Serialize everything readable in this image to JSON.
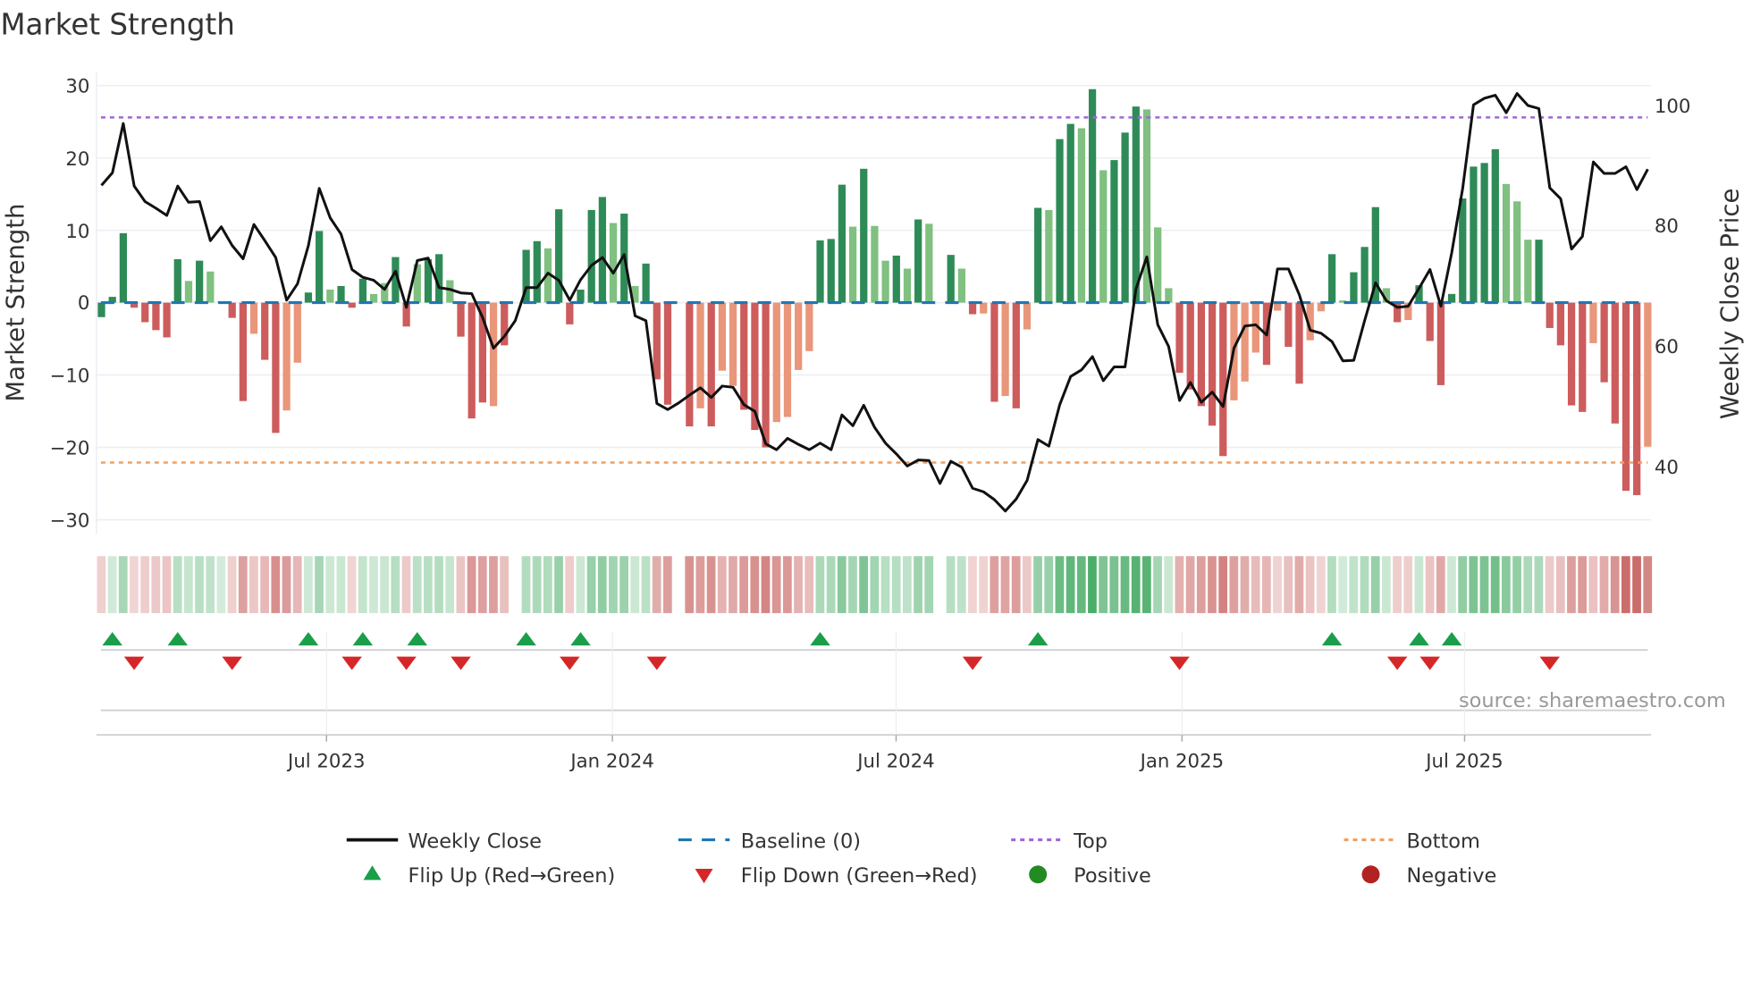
{
  "chart_data": {
    "type": "bar",
    "title": "Market Strength",
    "ylabel": "Market Strength",
    "y2label": "Weekly Close Price",
    "ylim": [
      -32,
      32
    ],
    "y2lim": [
      33,
      104
    ],
    "yticks": [
      "30",
      "20",
      "10",
      "0",
      "−10",
      "−20",
      "−30"
    ],
    "ytick_values": [
      30,
      20,
      10,
      0,
      -10,
      -20,
      -30
    ],
    "y2ticks": [
      "100",
      "80",
      "60",
      "40"
    ],
    "y2tick_values": [
      100,
      80,
      60,
      40
    ],
    "xticks": [
      "Jul 2023",
      "Jan 2024",
      "Jul 2024",
      "Jan 2025",
      "Jul 2025"
    ],
    "xtick_week_index": [
      21.2,
      47.5,
      73.5,
      99.7,
      125.7
    ],
    "top_level": 25.6,
    "bottom_level": -22.1,
    "baseline": 0,
    "grid": true,
    "legend_placement": "bottom",
    "strength": [
      -2.0,
      0.8,
      9.6,
      -0.7,
      -2.7,
      -3.8,
      -4.8,
      6.0,
      3.0,
      5.8,
      4.3,
      0.2,
      -2.1,
      -13.6,
      -4.3,
      -7.9,
      -18.0,
      -14.9,
      -8.3,
      1.4,
      9.9,
      1.8,
      2.3,
      -0.7,
      3.3,
      1.2,
      2.7,
      6.3,
      -3.3,
      5.3,
      6.0,
      6.7,
      3.1,
      -4.7,
      -16.0,
      -13.8,
      -14.3,
      -5.9,
      0,
      7.3,
      8.5,
      7.5,
      12.9,
      -3.0,
      1.8,
      12.8,
      14.6,
      11.0,
      12.3,
      2.3,
      5.4,
      -10.6,
      -14.1,
      0,
      -17.1,
      -14.6,
      -17.1,
      -9.4,
      -11.5,
      -14.8,
      -17.6,
      -20.0,
      -16.5,
      -15.8,
      -9.3,
      -6.7,
      8.6,
      8.8,
      16.3,
      10.5,
      18.5,
      10.6,
      5.8,
      6.5,
      4.7,
      11.5,
      10.9,
      0,
      6.6,
      4.7,
      -1.6,
      -1.5,
      -13.7,
      -12.9,
      -14.6,
      -3.7,
      13.1,
      12.8,
      22.6,
      24.7,
      24.1,
      29.5,
      18.3,
      19.7,
      23.5,
      27.1,
      26.7,
      10.4,
      2.0,
      -9.7,
      -12.0,
      -14.3,
      -17.0,
      -21.2,
      -13.5,
      -10.9,
      -6.9,
      -8.6,
      -1.1,
      -6.1,
      -11.2,
      -5.2,
      -1.2,
      6.7,
      0.3,
      4.2,
      7.7,
      13.2,
      2.0,
      -2.7,
      -2.4,
      2.4,
      -5.3,
      -11.4,
      1.2,
      14.4,
      18.8,
      19.3,
      21.2,
      16.4,
      14.0,
      8.7,
      8.7,
      -3.5,
      -5.9,
      -14.2,
      -15.1,
      -5.6,
      -11.0,
      -16.7,
      -26.0,
      -26.6,
      -19.9
    ],
    "bar_shade": "GGGRRRRGLGLLRRSRRSSGGLGRGLLGRLGGLRRRSRSGGLGRGGGLGLGRRSRSRSSRRRSSSSGGGLGLLGLGLSGLRSRSRSGLGGLGLGGGLLLRRRRRSSSRSRRSSGLGGGLRSGRRGGGGGLLLGRRRRSRRRRS",
    "weekly_close": [
      86.8,
      88.9,
      97.1,
      86.7,
      84.1,
      83.0,
      81.8,
      86.7,
      84.0,
      84.1,
      77.6,
      79.9,
      76.8,
      74.6,
      80.3,
      77.6,
      74.8,
      67.7,
      70.4,
      76.8,
      86.3,
      81.4,
      78.7,
      72.8,
      71.5,
      71.0,
      69.5,
      72.5,
      66.5,
      74.3,
      74.7,
      69.8,
      69.5,
      68.9,
      68.8,
      64.8,
      59.7,
      61.7,
      64.3,
      69.8,
      69.8,
      72.2,
      71.0,
      67.7,
      71.1,
      73.5,
      74.8,
      72.2,
      75.3,
      65.1,
      64.3,
      50.5,
      49.5,
      50.6,
      51.9,
      53.1,
      51.5,
      53.4,
      53.2,
      50.3,
      49.2,
      43.8,
      42.8,
      44.7,
      43.7,
      42.8,
      43.9,
      42.8,
      48.6,
      46.8,
      50.2,
      46.5,
      43.9,
      42.1,
      40.1,
      41.1,
      41.0,
      37.2,
      40.9,
      39.9,
      36.4,
      35.8,
      34.5,
      32.6,
      34.6,
      37.7,
      44.5,
      43.4,
      50.3,
      55.0,
      56.1,
      58.3,
      54.3,
      56.6,
      56.6,
      69.6,
      74.9,
      63.6,
      60.0,
      51.0,
      54.0,
      50.7,
      52.4,
      50.0,
      59.7,
      63.4,
      63.6,
      61.9,
      72.9,
      72.9,
      68.6,
      62.7,
      62.2,
      60.8,
      57.6,
      57.7,
      64.3,
      70.6,
      67.6,
      66.5,
      66.7,
      69.7,
      72.8,
      66.7,
      75.6,
      86.3,
      100.2,
      101.3,
      101.8,
      98.9,
      102.1,
      100.1,
      99.6,
      86.4,
      84.6,
      76.2,
      78.3,
      90.7,
      88.8,
      88.8,
      89.9,
      86.1,
      89.5
    ],
    "flip_up_weeks": [
      2,
      8,
      20,
      25,
      30,
      40,
      45,
      67,
      87,
      114,
      122,
      125
    ],
    "flip_down_weeks": [
      4,
      13,
      24,
      29,
      34,
      44,
      52,
      81,
      100,
      120,
      123,
      134
    ],
    "legend": [
      "Weekly Close",
      "Baseline (0)",
      "Top",
      "Bottom",
      "Flip Up (Red→Green)",
      "Flip Down (Green→Red)",
      "Positive",
      "Negative"
    ],
    "source": "source: sharemaestro.com"
  },
  "colors": {
    "strong_green": "#2e8b57",
    "light_green": "#80c080",
    "strong_red": "#cd5c5c",
    "light_red": "#e9967a",
    "line": "#111111",
    "baseline": "#1f77b4",
    "top": "#a066d8",
    "bottom": "#f0a060",
    "flip_up": "#1a9e4a",
    "flip_down": "#d62728",
    "positive": "#228b22",
    "negative": "#b22222",
    "grid": "#eceef3"
  }
}
